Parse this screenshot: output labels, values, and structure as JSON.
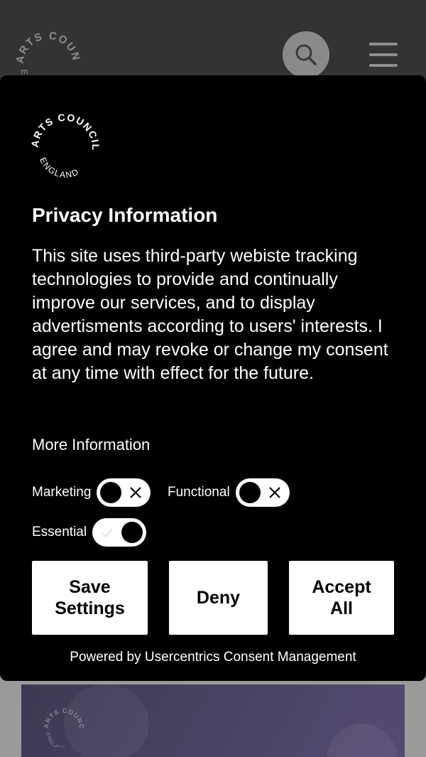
{
  "brand": {
    "logo_top": "ARTS COUNCIL",
    "logo_bottom": "ENGLAND"
  },
  "header": {
    "search_icon": "search-icon",
    "menu_icon": "hamburger-menu-icon"
  },
  "consent": {
    "title": "Privacy Information",
    "description": "This site uses third-party webiste tracking technologies to provide and continually improve our services, and to display advertisments according to users' interests. I agree and may revoke or change my consent at any time with effect for the future.",
    "more_info": "More Information",
    "toggles": [
      {
        "label": "Marketing",
        "enabled": false
      },
      {
        "label": "Functional",
        "enabled": false
      },
      {
        "label": "Essential",
        "enabled": true
      }
    ],
    "buttons": {
      "save_line1": "Save",
      "save_line2": "Settings",
      "deny": "Deny",
      "accept_line1": "Accept",
      "accept_line2": "All"
    },
    "powered_by": "Powered by Usercentrics Consent Management"
  },
  "colors": {
    "modal_bg": "#000000",
    "button_bg": "#ffffff",
    "header_bg": "#333333",
    "hero_bg": "#4a4563"
  }
}
